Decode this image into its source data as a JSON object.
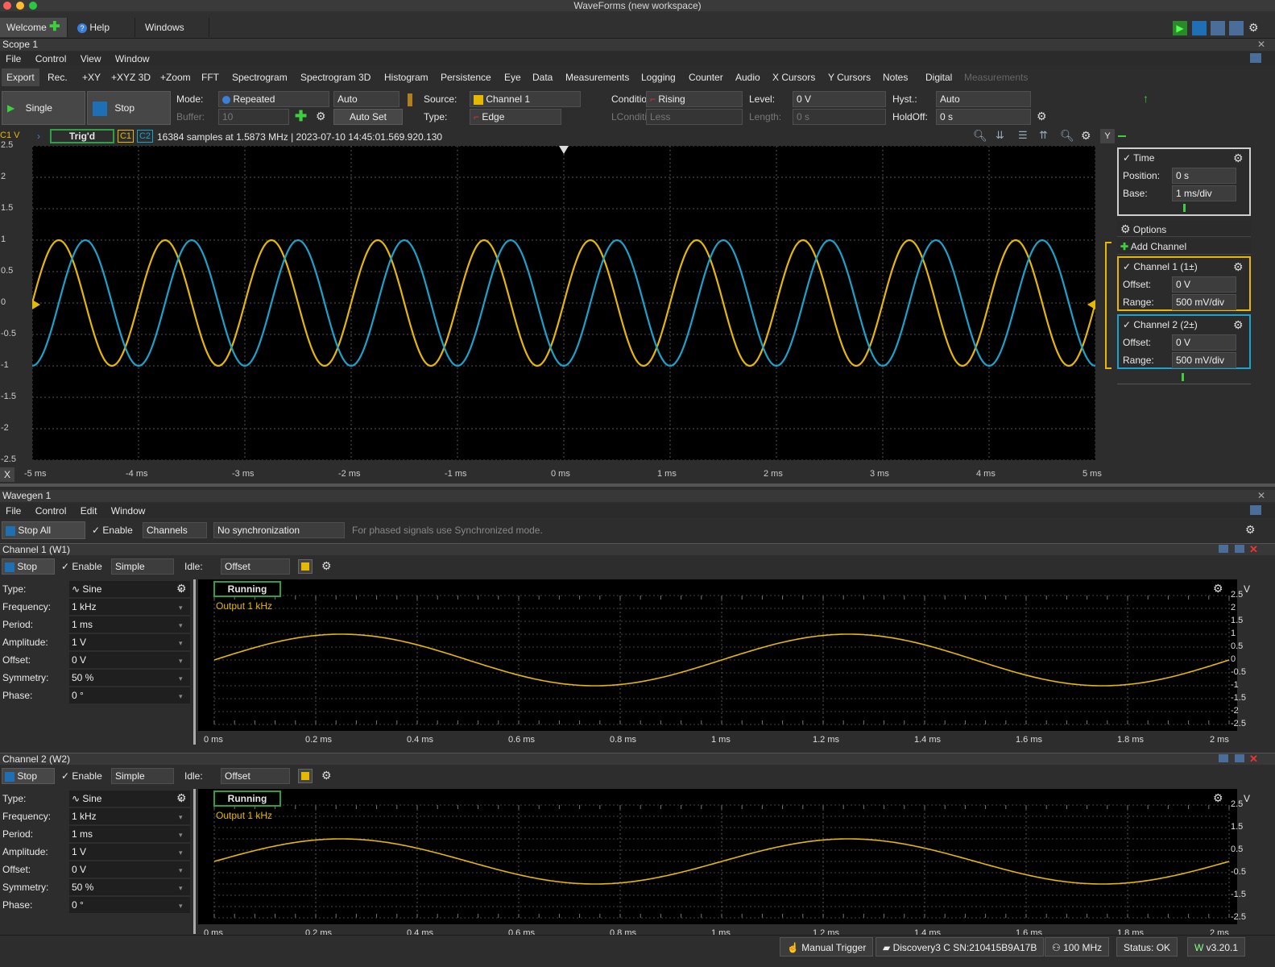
{
  "app": {
    "title": "WaveForms (new workspace)"
  },
  "tabs": [
    {
      "label": "Welcome"
    },
    {
      "label": "Help"
    },
    {
      "label": "Windows"
    }
  ],
  "scope": {
    "title": "Scope 1",
    "menu": [
      "File",
      "Control",
      "View",
      "Window"
    ],
    "views": [
      "Export",
      "Rec.",
      "+XY",
      "+XYZ 3D",
      "+Zoom",
      "FFT",
      "Spectrogram",
      "Spectrogram 3D",
      "Histogram",
      "Persistence",
      "Eye",
      "Data",
      "Measurements",
      "Logging",
      "Counter",
      "Audio",
      "X Cursors",
      "Y Cursors",
      "Notes",
      "Digital"
    ],
    "views_disabled": "Measurements",
    "single_label": "Single",
    "stop_label": "Stop",
    "mode_label": "Mode:",
    "mode_value": "Repeated",
    "auto_value": "Auto",
    "buffer_label": "Buffer:",
    "buffer_value": "10",
    "autoset_label": "Auto Set",
    "source_label": "Source:",
    "source_value": "Channel 1",
    "type_label": "Type:",
    "type_value": "Edge",
    "condition_label": "Condition:",
    "condition_value": "Rising",
    "lcondition_label": "LCondition:",
    "lcondition_value": "Less",
    "level_label": "Level:",
    "level_value": "0 V",
    "length_label": "Length:",
    "length_value": "0 s",
    "hyst_label": "Hyst.:",
    "hyst_value": "Auto",
    "holdoff_label": "HoldOff:",
    "holdoff_value": "0 s",
    "unit_label": "C1 V",
    "trig_status": "Trig'd",
    "c1": "C1",
    "c2": "C2",
    "info": "16384 samples at 1.5873 MHz | 2023-07-10 14:45:01.569.920.130",
    "y_btn": "Y",
    "x_btn": "X",
    "y_ticks": [
      "2.5",
      "2",
      "1.5",
      "1",
      "0.5",
      "0",
      "-0.5",
      "-1",
      "-1.5",
      "-2",
      "-2.5"
    ],
    "x_ticks": [
      "-5 ms",
      "-4 ms",
      "-3 ms",
      "-2 ms",
      "-1 ms",
      "0 ms",
      "1 ms",
      "2 ms",
      "3 ms",
      "4 ms",
      "5 ms"
    ],
    "time": {
      "label": "Time",
      "position_label": "Position:",
      "position_value": "0 s",
      "base_label": "Base:",
      "base_value": "1 ms/div"
    },
    "options_label": "Options",
    "add_channel_label": "Add Channel",
    "ch1": {
      "label": "Channel 1 (1±)",
      "offset_label": "Offset:",
      "offset_value": "0 V",
      "range_label": "Range:",
      "range_value": "500 mV/div"
    },
    "ch2": {
      "label": "Channel 2 (2±)",
      "offset_label": "Offset:",
      "offset_value": "0 V",
      "range_label": "Range:",
      "range_value": "500 mV/div"
    }
  },
  "wavegen": {
    "title": "Wavegen 1",
    "menu": [
      "File",
      "Control",
      "Edit",
      "Window"
    ],
    "stop_all_label": "Stop All",
    "enable_label": "Enable",
    "channels_value": "Channels",
    "sync_value": "No synchronization",
    "hint": "For phased signals use Synchronized mode.",
    "channels": [
      {
        "title": "Channel 1 (W1)",
        "stop_label": "Stop",
        "enable_label": "Enable",
        "mode_value": "Simple",
        "idle_label": "Idle:",
        "idle_value": "Offset",
        "type_label": "Type:",
        "type_value": "Sine",
        "frequency_label": "Frequency:",
        "frequency_value": "1 kHz",
        "period_label": "Period:",
        "period_value": "1 ms",
        "amplitude_label": "Amplitude:",
        "amplitude_value": "1 V",
        "offset_label": "Offset:",
        "offset_value": "0 V",
        "symmetry_label": "Symmetry:",
        "symmetry_value": "50 %",
        "phase_label": "Phase:",
        "phase_value": "0 °",
        "status": "Running",
        "output_label": "Output 1 kHz",
        "unit": "V",
        "y_ticks": [
          "2.5",
          "2",
          "1.5",
          "1",
          "0.5",
          "0",
          "-0.5",
          "-1",
          "-1.5",
          "-2",
          "-2.5"
        ],
        "x_ticks": [
          "0 ms",
          "0.2 ms",
          "0.4 ms",
          "0.6 ms",
          "0.8 ms",
          "1 ms",
          "1.2 ms",
          "1.4 ms",
          "1.6 ms",
          "1.8 ms",
          "2 ms"
        ]
      },
      {
        "title": "Channel 2 (W2)",
        "stop_label": "Stop",
        "enable_label": "Enable",
        "mode_value": "Simple",
        "idle_label": "Idle:",
        "idle_value": "Offset",
        "type_label": "Type:",
        "type_value": "Sine",
        "frequency_label": "Frequency:",
        "frequency_value": "1 kHz",
        "period_label": "Period:",
        "period_value": "1 ms",
        "amplitude_label": "Amplitude:",
        "amplitude_value": "1 V",
        "offset_label": "Offset:",
        "offset_value": "0 V",
        "symmetry_label": "Symmetry:",
        "symmetry_value": "50 %",
        "phase_label": "Phase:",
        "phase_value": "0 °",
        "status": "Running",
        "output_label": "Output 1 kHz",
        "unit": "V",
        "y_ticks": [
          "2.5",
          "1.5",
          "0.5",
          "-0.5",
          "-1.5",
          "-2.5"
        ],
        "x_ticks": [
          "0 ms",
          "0.2 ms",
          "0.4 ms",
          "0.6 ms",
          "0.8 ms",
          "1 ms",
          "1.2 ms",
          "1.4 ms",
          "1.6 ms",
          "1.8 ms",
          "2 ms"
        ]
      }
    ]
  },
  "statusbar": {
    "manual_trigger": "Manual Trigger",
    "device": "Discovery3 C SN:210415B9A17B",
    "freq": "100 MHz",
    "status": "Status: OK",
    "version": "v3.20.1"
  },
  "colors": {
    "ch1": "#e6b800",
    "ch2": "#1aa3cc",
    "running": "#2ea043",
    "stop": "#1f6fb5"
  }
}
